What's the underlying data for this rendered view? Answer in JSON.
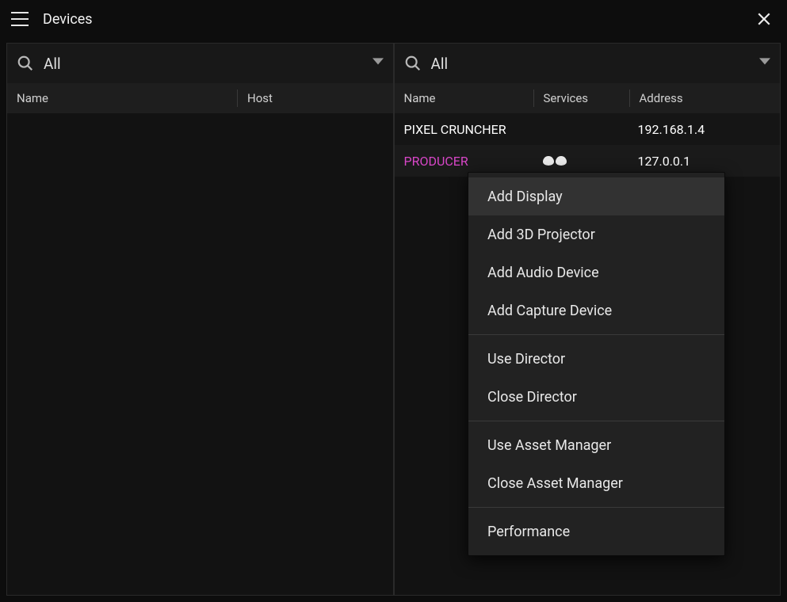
{
  "titlebar": {
    "title": "Devices"
  },
  "left_panel": {
    "search_label": "All",
    "columns": {
      "name": "Name",
      "host": "Host"
    },
    "rows": []
  },
  "right_panel": {
    "search_label": "All",
    "columns": {
      "name": "Name",
      "services": "Services",
      "address": "Address"
    },
    "rows": [
      {
        "name": "PIXEL CRUNCHER",
        "services": "",
        "address": "192.168.1.4",
        "selected": false
      },
      {
        "name": "PRODUCER",
        "services": "●●",
        "address": "127.0.0.1",
        "selected": true
      }
    ]
  },
  "context_menu": {
    "items": [
      {
        "label": "Add Display",
        "hover": true
      },
      {
        "label": "Add 3D Projector",
        "hover": false
      },
      {
        "label": "Add Audio Device",
        "hover": false
      },
      {
        "label": "Add Capture Device",
        "hover": false
      },
      {
        "sep": true
      },
      {
        "label": "Use Director",
        "hover": false
      },
      {
        "label": "Close Director",
        "hover": false
      },
      {
        "sep": true
      },
      {
        "label": "Use Asset Manager",
        "hover": false
      },
      {
        "label": "Close Asset Manager",
        "hover": false
      },
      {
        "sep": true
      },
      {
        "label": "Performance",
        "hover": false
      }
    ]
  }
}
